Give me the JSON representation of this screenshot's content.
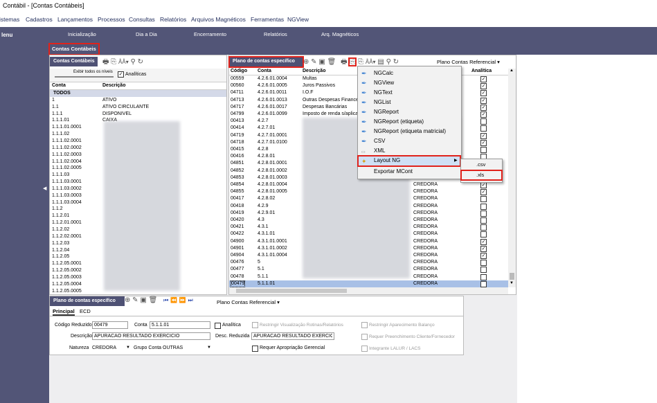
{
  "window": {
    "title": "Contábil - [Contas Contábeis]"
  },
  "menubar": [
    "istemas",
    "Cadastros",
    "Lançamentos",
    "Processos",
    "Consultas",
    "Relatórios",
    "Arquivos Magnéticos",
    "Ferramentas",
    "NGView"
  ],
  "leftnav": {
    "menu_label": "lenu"
  },
  "topnav": [
    "Inicialização",
    "Dia a Dia",
    "Encerramento",
    "Relatórios",
    "Arq. Magnéticos"
  ],
  "doc_tab": "Contas Contábeis",
  "left_panel": {
    "header": "Contas Contábeis",
    "expand_label": "Exibir todos os níveis",
    "analiticas_label": "Analíticas",
    "col_conta": "Conta",
    "col_descricao": "Descrição",
    "rows": [
      {
        "conta": "TODOS",
        "desc": ""
      },
      {
        "conta": "1",
        "desc": "ATIVO"
      },
      {
        "conta": "1.1",
        "desc": "ATIVO CIRCULANTE"
      },
      {
        "conta": "1.1.1",
        "desc": "DISPONIVEL"
      },
      {
        "conta": "1.1.1.01",
        "desc": "CAIXA"
      },
      {
        "conta": "1.1.1.01.0001",
        "desc": ""
      },
      {
        "conta": "1.1.1.02",
        "desc": ""
      },
      {
        "conta": "1.1.1.02.0001",
        "desc": ""
      },
      {
        "conta": "1.1.1.02.0002",
        "desc": ""
      },
      {
        "conta": "1.1.1.02.0003",
        "desc": ""
      },
      {
        "conta": "1.1.1.02.0004",
        "desc": ""
      },
      {
        "conta": "1.1.1.02.0005",
        "desc": ""
      },
      {
        "conta": "1.1.1.03",
        "desc": ""
      },
      {
        "conta": "1.1.1.03.0001",
        "desc": ""
      },
      {
        "conta": "1.1.1.03.0002",
        "desc": ""
      },
      {
        "conta": "1.1.1.03.0003",
        "desc": ""
      },
      {
        "conta": "1.1.1.03.0004",
        "desc": ""
      },
      {
        "conta": "1.1.2",
        "desc": ""
      },
      {
        "conta": "1.1.2.01",
        "desc": ""
      },
      {
        "conta": "1.1.2.01.0001",
        "desc": ""
      },
      {
        "conta": "1.1.2.02",
        "desc": ""
      },
      {
        "conta": "1.1.2.02.0001",
        "desc": ""
      },
      {
        "conta": "1.1.2.03",
        "desc": ""
      },
      {
        "conta": "1.1.2.04",
        "desc": ""
      },
      {
        "conta": "1.1.2.05",
        "desc": ""
      },
      {
        "conta": "1.1.2.05.0001",
        "desc": ""
      },
      {
        "conta": "1.1.2.05.0002",
        "desc": ""
      },
      {
        "conta": "1.1.2.05.0003",
        "desc": ""
      },
      {
        "conta": "1.1.2.05.0004",
        "desc": ""
      },
      {
        "conta": "1.1.2.05.0005",
        "desc": ""
      },
      {
        "conta": "1.1.2.05.0006",
        "desc": ""
      }
    ]
  },
  "right_panel": {
    "header": "Plano de contas específico",
    "toolbar_dropdown": "Plano Contas Referencial",
    "columns": {
      "codigo": "Código",
      "conta": "Conta",
      "descricao": "Descrição",
      "analitica": "Analítica"
    },
    "rows": [
      {
        "codigo": "00559",
        "conta": "4.2.6.01.0004",
        "desc": "Multas",
        "natureza": "",
        "checked": true
      },
      {
        "codigo": "00560",
        "conta": "4.2.6.01.0005",
        "desc": "Juros Passivos",
        "natureza": "",
        "checked": true
      },
      {
        "codigo": "04711",
        "conta": "4.2.6.01.0011",
        "desc": "I.O.F",
        "natureza": "",
        "checked": true
      },
      {
        "codigo": "04713",
        "conta": "4.2.6.01.0013",
        "desc": "Outras Despesas Finance",
        "natureza": "",
        "checked": true
      },
      {
        "codigo": "04717",
        "conta": "4.2.6.01.0017",
        "desc": "Despesas Bancárias",
        "natureza": "",
        "checked": true
      },
      {
        "codigo": "04799",
        "conta": "4.2.6.01.0099",
        "desc": "Imposto de renda s/aplica",
        "natureza": "",
        "checked": true
      },
      {
        "codigo": "00413",
        "conta": "4.2.7",
        "desc": "",
        "natureza": "",
        "checked": false
      },
      {
        "codigo": "00414",
        "conta": "4.2.7.01",
        "desc": "",
        "natureza": "",
        "checked": false
      },
      {
        "codigo": "04719",
        "conta": "4.2.7.01.0001",
        "desc": "",
        "natureza": "",
        "checked": true
      },
      {
        "codigo": "04718",
        "conta": "4.2.7.01.0100",
        "desc": "",
        "natureza": "",
        "checked": true
      },
      {
        "codigo": "00415",
        "conta": "4.2.8",
        "desc": "",
        "natureza": "",
        "checked": false
      },
      {
        "codigo": "00416",
        "conta": "4.2.8.01",
        "desc": "",
        "natureza": "",
        "checked": false
      },
      {
        "codigo": "04851",
        "conta": "4.2.8.01.0001",
        "desc": "",
        "natureza": "",
        "checked": true
      },
      {
        "codigo": "04852",
        "conta": "4.2.8.01.0002",
        "desc": "",
        "natureza": "",
        "checked": true
      },
      {
        "codigo": "04853",
        "conta": "4.2.8.01.0003",
        "desc": "",
        "natureza": "CREDORA",
        "checked": true
      },
      {
        "codigo": "04854",
        "conta": "4.2.8.01.0004",
        "desc": "",
        "natureza": "CREDORA",
        "checked": true
      },
      {
        "codigo": "04855",
        "conta": "4.2.8.01.0005",
        "desc": "",
        "natureza": "CREDORA",
        "checked": true
      },
      {
        "codigo": "00417",
        "conta": "4.2.8.02",
        "desc": "",
        "natureza": "CREDORA",
        "checked": false
      },
      {
        "codigo": "00418",
        "conta": "4.2.9",
        "desc": "",
        "natureza": "CREDORA",
        "checked": false
      },
      {
        "codigo": "00419",
        "conta": "4.2.9.01",
        "desc": "",
        "natureza": "CREDORA",
        "checked": false
      },
      {
        "codigo": "00420",
        "conta": "4.3",
        "desc": "",
        "natureza": "CREDORA",
        "checked": false
      },
      {
        "codigo": "00421",
        "conta": "4.3.1",
        "desc": "",
        "natureza": "CREDORA",
        "checked": false
      },
      {
        "codigo": "00422",
        "conta": "4.3.1.01",
        "desc": "",
        "natureza": "CREDORA",
        "checked": false
      },
      {
        "codigo": "04900",
        "conta": "4.3.1.01.0001",
        "desc": "",
        "natureza": "CREDORA",
        "checked": true
      },
      {
        "codigo": "04901",
        "conta": "4.3.1.01.0002",
        "desc": "",
        "natureza": "CREDORA",
        "checked": true
      },
      {
        "codigo": "04904",
        "conta": "4.3.1.01.0004",
        "desc": "",
        "natureza": "CREDORA",
        "checked": true
      },
      {
        "codigo": "00476",
        "conta": "5",
        "desc": "",
        "natureza": "CREDORA",
        "checked": false
      },
      {
        "codigo": "00477",
        "conta": "5.1",
        "desc": "",
        "natureza": "CREDORA",
        "checked": false
      },
      {
        "codigo": "00478",
        "conta": "5.1.1",
        "desc": "",
        "natureza": "CREDORA",
        "checked": false
      },
      {
        "codigo": "00479",
        "conta": "5.1.1.01",
        "desc": "",
        "natureza": "CREDORA",
        "checked": false,
        "selected": true
      }
    ]
  },
  "context_menu": {
    "items": [
      "NGCalc",
      "NGView",
      "NGText",
      "NGList",
      "NGReport",
      "NGReport (etiqueta)",
      "NGReport (etiqueta matricial)",
      "CSV",
      "XML",
      "Layout NG",
      "Exportar MCont"
    ],
    "submenu": [
      ".csv",
      ".xls"
    ]
  },
  "detail": {
    "header": "Plano de contas específico",
    "dropdown": "Plano Contas Referencial",
    "tabs": [
      "Principal",
      "ECD"
    ],
    "codigo_reduzido_label": "Código Reduzido",
    "codigo_reduzido": "00479",
    "conta_label": "Conta",
    "conta": "5.1.1.01",
    "analitica_label": "Analítica",
    "descricao_label": "Descrição",
    "descricao": "APURACAO RESULTADO EXERCICIO",
    "desc_reduzida_label": "Desc. Reduzida",
    "desc_reduzida": "APURACAO RESULTADO EXERCICIO",
    "natureza_label": "Natureza",
    "natureza": "CREDORA",
    "grupo_label": "Grupo Conta",
    "grupo": "OUTRAS",
    "requer_apropriacao": "Requer Apropriação Gerencial",
    "restringir_rotinas": "Restringir Visualização Rotinas/Relatórios",
    "restringir_balanco": "Restringir Aparecimento Balanço",
    "requer_preenchimento": "Requer Preenchimento Cliente/Fornecedor",
    "integrante_lalur": "Integrante LALUR / LACS"
  }
}
